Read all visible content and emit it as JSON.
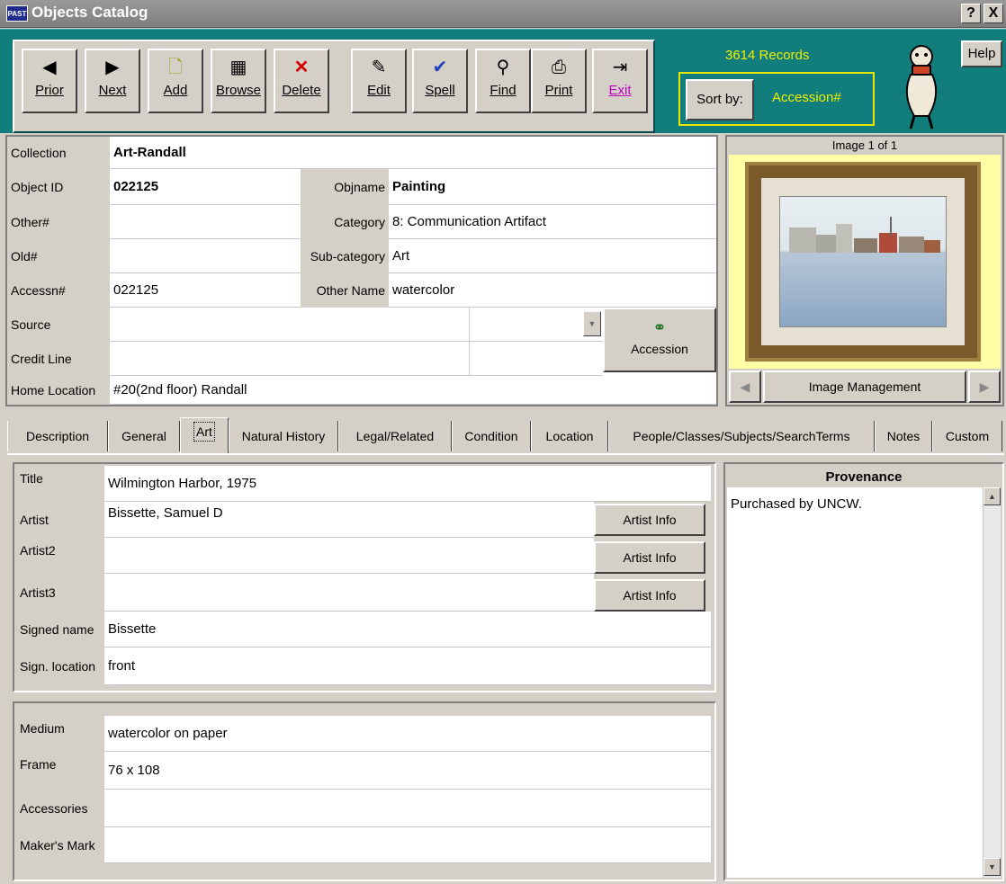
{
  "window": {
    "badge": "PAST",
    "title": "Objects Catalog",
    "help_glyph": "?",
    "close_glyph": "X"
  },
  "toolbar": {
    "buttons": [
      {
        "label": "Prior",
        "icon": "left-arrow-icon",
        "glyph": "◀"
      },
      {
        "label": "Next",
        "icon": "right-arrow-icon",
        "glyph": "▶"
      },
      {
        "label": "Add",
        "icon": "new-document-icon",
        "glyph": "🗋"
      },
      {
        "label": "Browse",
        "icon": "grid-icon",
        "glyph": "▦"
      },
      {
        "label": "Delete",
        "icon": "delete-x-icon",
        "glyph": "✕"
      },
      {
        "label": "Edit",
        "icon": "edit-icon",
        "glyph": "✎"
      },
      {
        "label": "Spell",
        "icon": "spellcheck-icon",
        "glyph": "✔"
      },
      {
        "label": "Find",
        "icon": "binoculars-icon",
        "glyph": "⚲"
      },
      {
        "label": "Print",
        "icon": "printer-icon",
        "glyph": "⎙"
      },
      {
        "label": "Exit",
        "icon": "exit-door-icon",
        "glyph": "⇥"
      }
    ],
    "records": "3614 Records",
    "sort_label": "Sort by:",
    "sort_value": "Accession#",
    "help": "Help"
  },
  "form": {
    "collection_label": "Collection",
    "collection": "Art-Randall",
    "object_id_label": "Object ID",
    "object_id": "022125",
    "objname_label": "Objname",
    "objname": "Painting",
    "other_num_label": "Other#",
    "other_num": "",
    "category_label": "Category",
    "category": "8: Communication Artifact",
    "old_num_label": "Old#",
    "old_num": "",
    "subcategory_label": "Sub-category",
    "subcategory": "Art",
    "accessn_label": "Accessn#",
    "accessn": "022125",
    "other_name_label": "Other Name",
    "other_name": "watercolor",
    "source_label": "Source",
    "source": "",
    "credit_line_label": "Credit Line",
    "credit_line": "",
    "home_location_label": "Home Location",
    "home_location": "#20(2nd floor) Randall",
    "accession_button": "Accession"
  },
  "image_panel": {
    "caption": "Image 1 of 1",
    "manage_button": "Image Management"
  },
  "tabs": [
    "Description",
    "General",
    "Art",
    "Natural History",
    "Legal/Related",
    "Condition",
    "Location",
    "People/Classes/Subjects/SearchTerms",
    "Notes",
    "Custom"
  ],
  "active_tab": "Art",
  "art": {
    "title_label": "Title",
    "title": "Wilmington Harbor, 1975",
    "artist_label": "Artist",
    "artist": "Bissette, Samuel D",
    "artist2_label": "Artist2",
    "artist2": "",
    "artist3_label": "Artist3",
    "artist3": "",
    "artist_info_button": "Artist Info",
    "signed_name_label": "Signed name",
    "signed_name": "Bissette",
    "sign_location_label": "Sign. location",
    "sign_location": "front",
    "medium_label": "Medium",
    "medium": "watercolor on paper",
    "frame_label": "Frame",
    "frame": "76 x 108",
    "accessories_label": "Accessories",
    "accessories": "",
    "makers_mark_label": "Maker's Mark",
    "makers_mark": ""
  },
  "provenance": {
    "title": "Provenance",
    "text": "Purchased by UNCW."
  },
  "colors": {
    "toolbar_bg": "#127d7d",
    "highlight_text": "#f0f000",
    "image_bg": "#ffffa8",
    "window_bg": "#d4d0c8"
  }
}
